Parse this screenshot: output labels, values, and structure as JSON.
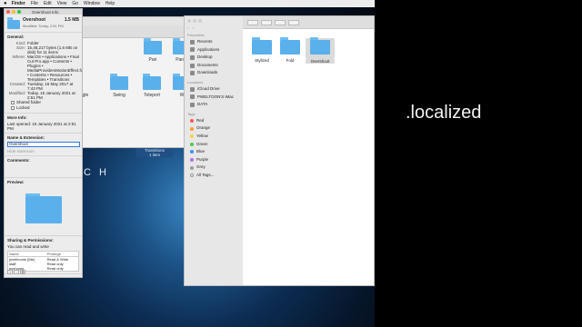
{
  "menubar": {
    "apple": "",
    "items": [
      "Finder",
      "File",
      "Edit",
      "View",
      "Go",
      "Window",
      "Help"
    ]
  },
  "desktop": {
    "text": "C H"
  },
  "bg_window": {
    "title": "TCR Demo Transitions",
    "items_row1": [
      "Pan",
      "Pan S"
    ],
    "items_row2": [
      "gle",
      "Swing",
      "Teleport",
      "W"
    ],
    "strip": [
      "Transitions",
      "1 item"
    ]
  },
  "info_panel": {
    "title": "Overshoot Info",
    "name": "Overshoot",
    "modified": "Modified: Today, 2:51 PM",
    "size": "1.5 MB",
    "general_label": "General:",
    "general": [
      {
        "k": "Kind:",
        "v": "Folder"
      },
      {
        "k": "Size:",
        "v": "15,48,217 bytes (1.6 MB on disk) for 11 items"
      },
      {
        "k": "Where:",
        "v": "MacOS • Applications • Final Cut Pro.app • Contents • Plugins • MediaProvidersMotionEffect.fxp • Contents • Resources • Templates • Transitions"
      },
      {
        "k": "Created:",
        "v": "Tuesday, 16 May 2017 at 7:43 PM"
      },
      {
        "k": "Modified:",
        "v": "Today, 15 January 2021 at 2:51 PM"
      }
    ],
    "shared_folder": "Shared folder",
    "locked": "Locked",
    "more_info_label": "More Info:",
    "last_opened": "Last opened: 15 January 2021 at 2:51 PM",
    "name_ext_label": "Name & Extension:",
    "name_value": "Overshoot",
    "hide_ext": "Hide extension",
    "comments_label": "Comments:",
    "preview_label": "Preview:",
    "sharing_label": "Sharing & Permissions:",
    "sharing_note": "You can read and write",
    "perm_headers": [
      "Name",
      "Privilege"
    ],
    "perm_rows": [
      {
        "name": "jnvellnoms (Me)",
        "priv": "Read & Write"
      },
      {
        "name": "staff",
        "priv": "Read only"
      },
      {
        "name": "everyone",
        "priv": "Read only"
      }
    ]
  },
  "finder": {
    "favourites_label": "Favourites",
    "favourites": [
      "Recents",
      "Applications",
      "Desktop",
      "Documents",
      "Downloads"
    ],
    "locations_label": "Locations",
    "locations": [
      "iCloud Drive",
      "PWELTOON'S iMac",
      "DATA"
    ],
    "tags_label": "Tags",
    "tags": [
      {
        "name": "Red",
        "color": "#fc5753"
      },
      {
        "name": "Orange",
        "color": "#fd9a2a"
      },
      {
        "name": "Yellow",
        "color": "#fdd33a"
      },
      {
        "name": "Green",
        "color": "#4dc94a"
      },
      {
        "name": "Blue",
        "color": "#3a8ef6"
      },
      {
        "name": "Purple",
        "color": "#b26be3"
      },
      {
        "name": "Grey",
        "color": "#9a9a9a"
      },
      {
        "name": "All Tags...",
        "color": ""
      }
    ],
    "items": [
      "Stylized",
      "Fold",
      "Overshoot"
    ],
    "selected": "Overshoot"
  },
  "overlay": {
    "text": ".localized"
  },
  "colors": {
    "folder": "#5ab0ea",
    "selection": "#2b78e4"
  }
}
